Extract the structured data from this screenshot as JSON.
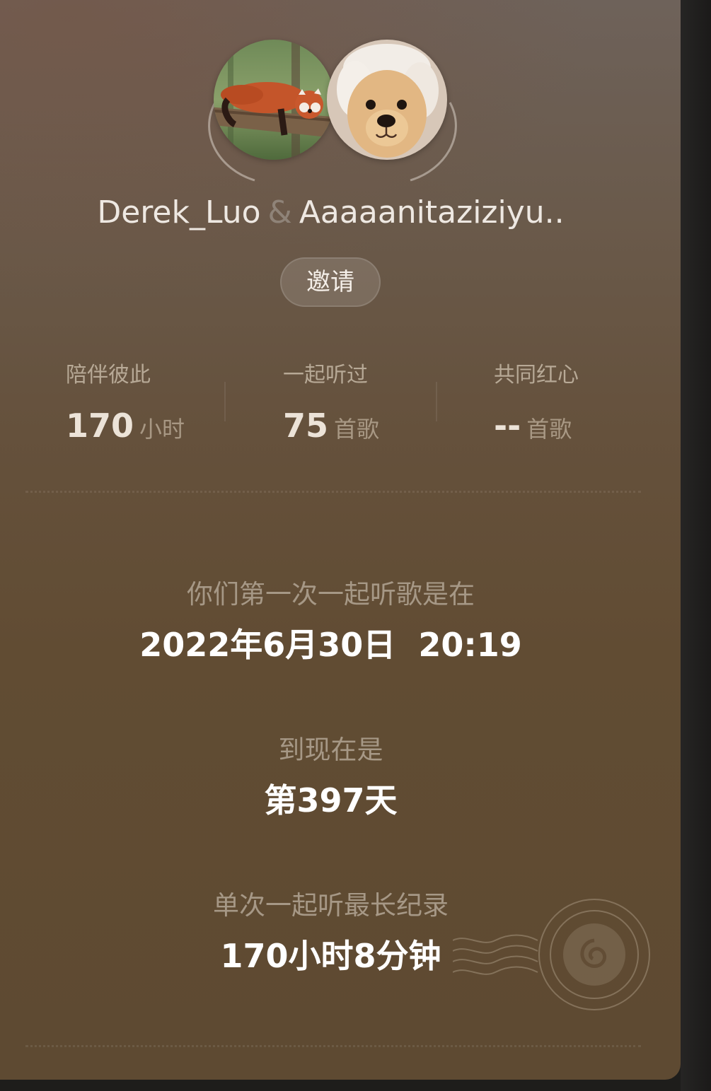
{
  "profile": {
    "user_a": "Derek_Luo",
    "separator": "&",
    "user_b": "Aaaaanitaziziyu..",
    "invite_label": "邀请"
  },
  "stats": [
    {
      "label": "陪伴彼此",
      "value": "170",
      "unit": "小时"
    },
    {
      "label": "一起听过",
      "value": "75",
      "unit": "首歌"
    },
    {
      "label": "共同红心",
      "value": "--",
      "unit": "首歌"
    }
  ],
  "first_listen": {
    "caption": "你们第一次一起听歌是在",
    "value": "2022年6月30日  20:19"
  },
  "days": {
    "caption": "到现在是",
    "value": "第397天"
  },
  "longest": {
    "caption": "单次一起听最长纪录",
    "value": "170小时8分钟"
  },
  "icons": {
    "avatar_a": "red-panda-avatar",
    "avatar_b": "golden-puppy-avatar",
    "stamp": "netease-music-postmark-stamp"
  },
  "colors": {
    "background_top": "#6e625a",
    "background_bottom": "#5e4a32",
    "text_primary": "#ffffff",
    "text_muted": "#a69886"
  }
}
